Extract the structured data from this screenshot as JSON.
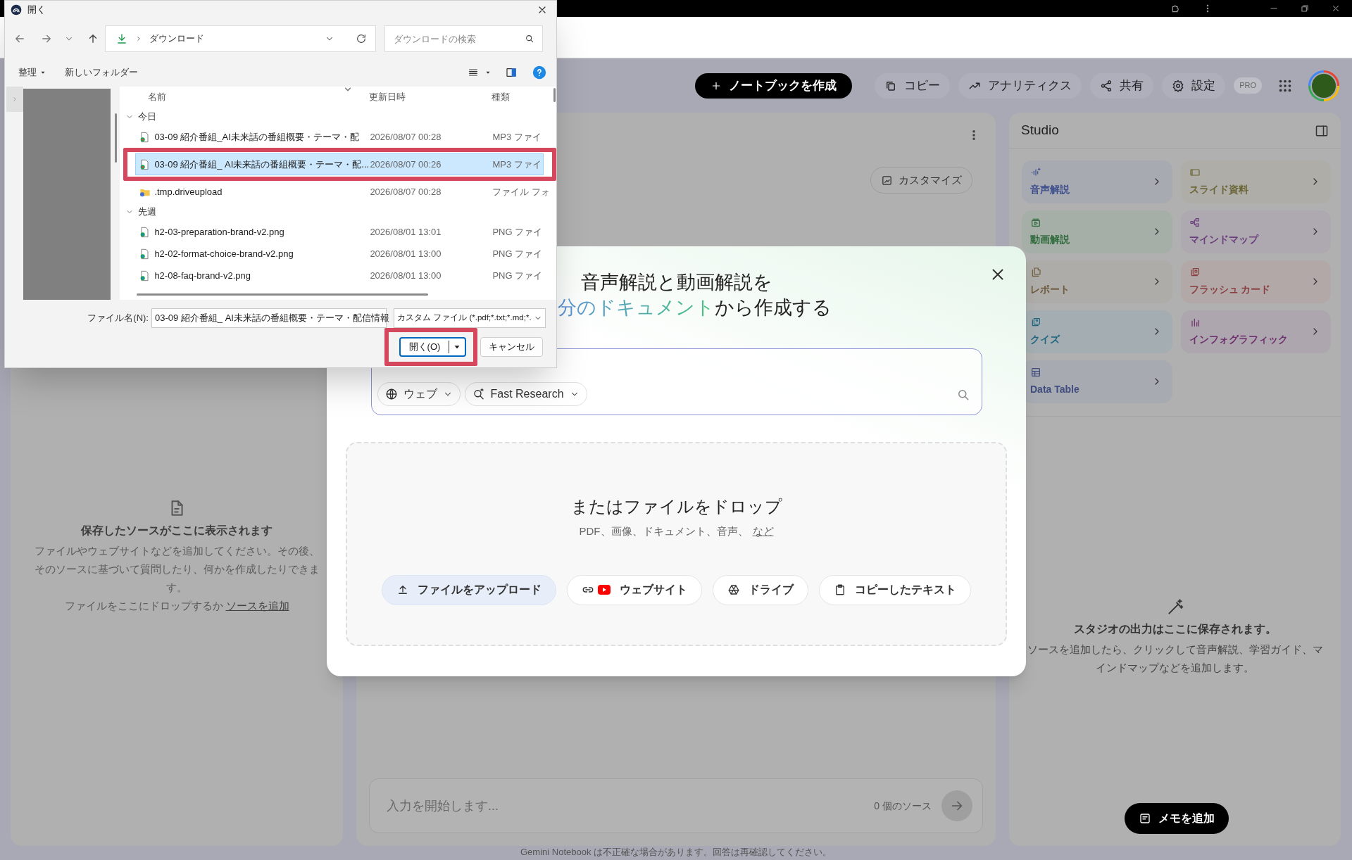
{
  "header": {
    "create_button": "ノートブックを作成",
    "actions": [
      {
        "kind": "copy",
        "label": "コピー"
      },
      {
        "kind": "analytics",
        "label": "アナリティクス"
      },
      {
        "kind": "share",
        "label": "共有"
      },
      {
        "kind": "settings",
        "label": "設定"
      }
    ],
    "plan_badge": "PRO"
  },
  "sources_panel": {
    "empty_title": "保存したソースがここに表示されます",
    "empty_text": "ファイルやウェブサイトなどを追加してください。その後、そのソースに基づいて質問したり、何かを作成したりできます。",
    "drop_hint": "ファイルをここにドロップするか",
    "add_link": "ソースを追加"
  },
  "chat_panel": {
    "customize_button": "カスタマイズ",
    "input_placeholder": "入力を開始します...",
    "source_count": "0 個のソース",
    "disclaimer": "Gemini Notebook は不正確な場合があります。回答は再確認してください。"
  },
  "studio": {
    "title": "Studio",
    "tools": [
      {
        "kind": "audio",
        "label": "音声解説",
        "color": "#3d4f8c"
      },
      {
        "kind": "slides",
        "label": "スライド資料",
        "color": "#6b6437"
      },
      {
        "kind": "video",
        "label": "動画解説",
        "color": "#2f6b3c"
      },
      {
        "kind": "mindmap",
        "label": "マインドマップ",
        "color": "#6b3f7d"
      },
      {
        "kind": "report",
        "label": "レポート",
        "color": "#6e5b3d"
      },
      {
        "kind": "flashcards",
        "label": "フラッシュ カード",
        "color": "#8a4040"
      },
      {
        "kind": "quiz",
        "label": "クイズ",
        "color": "#1f6680"
      },
      {
        "kind": "infographic",
        "label": "インフォグラフィック",
        "color": "#6d2f6d"
      },
      {
        "kind": "table",
        "label": "Data Table",
        "color": "#3f4d7f"
      }
    ],
    "empty_title": "スタジオの出力はここに保存されます。",
    "empty_text": "ソースを追加したら、クリックして音声解説、学習ガイド、マインドマップなどを追加します。",
    "note_button": "メモを追加"
  },
  "modal": {
    "title_line_1": "音声解説と動画解説を",
    "title_line_2": {
      "highlight": "分のドキュメント",
      "rest": "から作成する"
    },
    "search_chips": [
      {
        "kind": "web",
        "label": "ウェブ"
      },
      {
        "kind": "research",
        "label": "Fast Research"
      }
    ],
    "drop_title": "またはファイルをドロップ",
    "drop_text": "PDF、画像、ドキュメント、音声、",
    "drop_link": "など",
    "upload_options": [
      {
        "kind": "upload",
        "label": "ファイルをアップロード"
      },
      {
        "kind": "website",
        "label": "ウェブサイト"
      },
      {
        "kind": "drive",
        "label": "ドライブ"
      },
      {
        "kind": "text",
        "label": "コピーしたテキスト"
      }
    ]
  },
  "file_dialog": {
    "title": "開く",
    "location": "ダウンロード",
    "search_placeholder": "ダウンロードの検索",
    "organize_button": "整理",
    "new_folder_button": "新しいフォルダー",
    "columns": [
      "名前",
      "更新日時",
      "種類"
    ],
    "groups": [
      {
        "label": "今日",
        "expanded": true,
        "files": [
          {
            "kind": "audio",
            "name": "03-09 紹介番組_AI未来話の番組概要・テーマ・配",
            "modified": "2026/08/07 00:28",
            "type": "MP3 ファイ",
            "selected": false,
            "highlighted": false
          },
          {
            "kind": "audio",
            "name": "03-09 紹介番組_ AI未来話の番組概要・テーマ・配...",
            "modified": "2026/08/07 00:26",
            "type": "MP3 ファイ",
            "selected": true,
            "highlighted": true
          },
          {
            "kind": "folder",
            "name": ".tmp.driveupload",
            "modified": "2026/08/07 00:28",
            "type": "ファイル フォ",
            "selected": false,
            "highlighted": false
          }
        ]
      },
      {
        "label": "先週",
        "expanded": true,
        "files": [
          {
            "kind": "image",
            "name": "h2-03-preparation-brand-v2.png",
            "modified": "2026/08/01 13:01",
            "type": "PNG ファイ",
            "selected": false,
            "highlighted": false
          },
          {
            "kind": "image",
            "name": "h2-02-format-choice-brand-v2.png",
            "modified": "2026/08/01 13:00",
            "type": "PNG ファイ",
            "selected": false,
            "highlighted": false
          },
          {
            "kind": "image",
            "name": "h2-08-faq-brand-v2.png",
            "modified": "2026/08/01 13:00",
            "type": "PNG ファイ",
            "selected": false,
            "highlighted": false
          }
        ]
      }
    ],
    "file_name_label": "ファイル名(N):",
    "file_name": "03-09 紹介番組_ AI未来話の番組概要・テーマ・配信情報",
    "file_type": "カスタム ファイル (*.pdf;*.txt;*.md;*.",
    "open_button": {
      "label": "開く(O)",
      "highlighted": true
    },
    "cancel_button": "キャンセル"
  }
}
